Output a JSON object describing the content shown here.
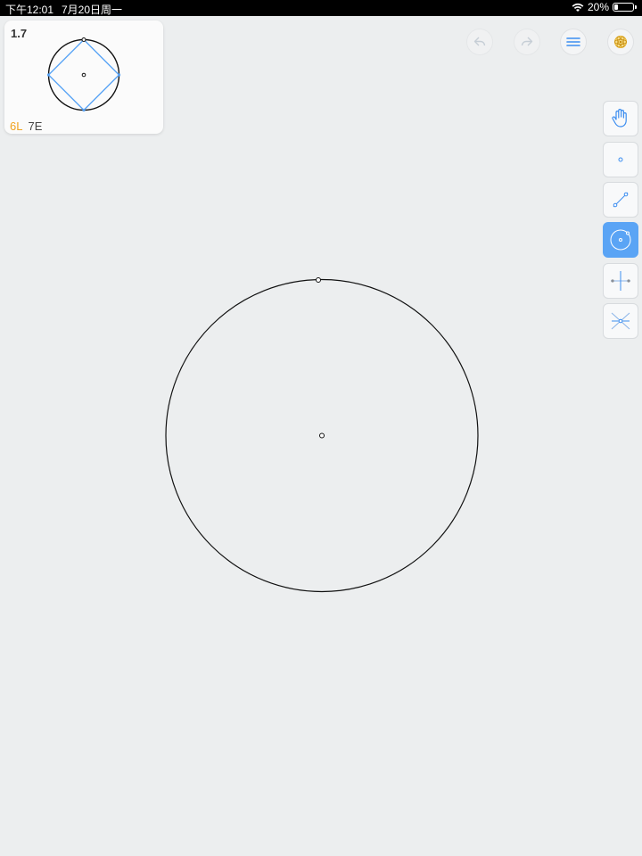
{
  "status_bar": {
    "time": "下午12:01",
    "date": "7月20日周一",
    "battery_text": "20%",
    "battery_level": 0.2
  },
  "level_card": {
    "level": "1.7",
    "goal_l": "6L",
    "goal_e": "7E"
  },
  "toolbar": {
    "undo_icon": "undo-icon",
    "redo_icon": "redo-icon",
    "menu_icon": "menu-icon",
    "hint_icon": "lightbulb-icon"
  },
  "tools": [
    {
      "name": "move",
      "icon": "hand-icon",
      "active": false
    },
    {
      "name": "point",
      "icon": "point-icon",
      "active": false
    },
    {
      "name": "line",
      "icon": "line-icon",
      "active": false
    },
    {
      "name": "circle",
      "icon": "circle-icon",
      "active": true
    },
    {
      "name": "perpendicular-bisector",
      "icon": "perpendicular-bisector-icon",
      "active": false
    },
    {
      "name": "angle-bisector",
      "icon": "angle-bisector-icon",
      "active": false
    }
  ],
  "colors": {
    "accent": "#5aa4f5",
    "goal_lines": "#f1a31f",
    "goal_points": "#444444",
    "construction": "#000000",
    "target_shape": "#5aa4f5"
  }
}
